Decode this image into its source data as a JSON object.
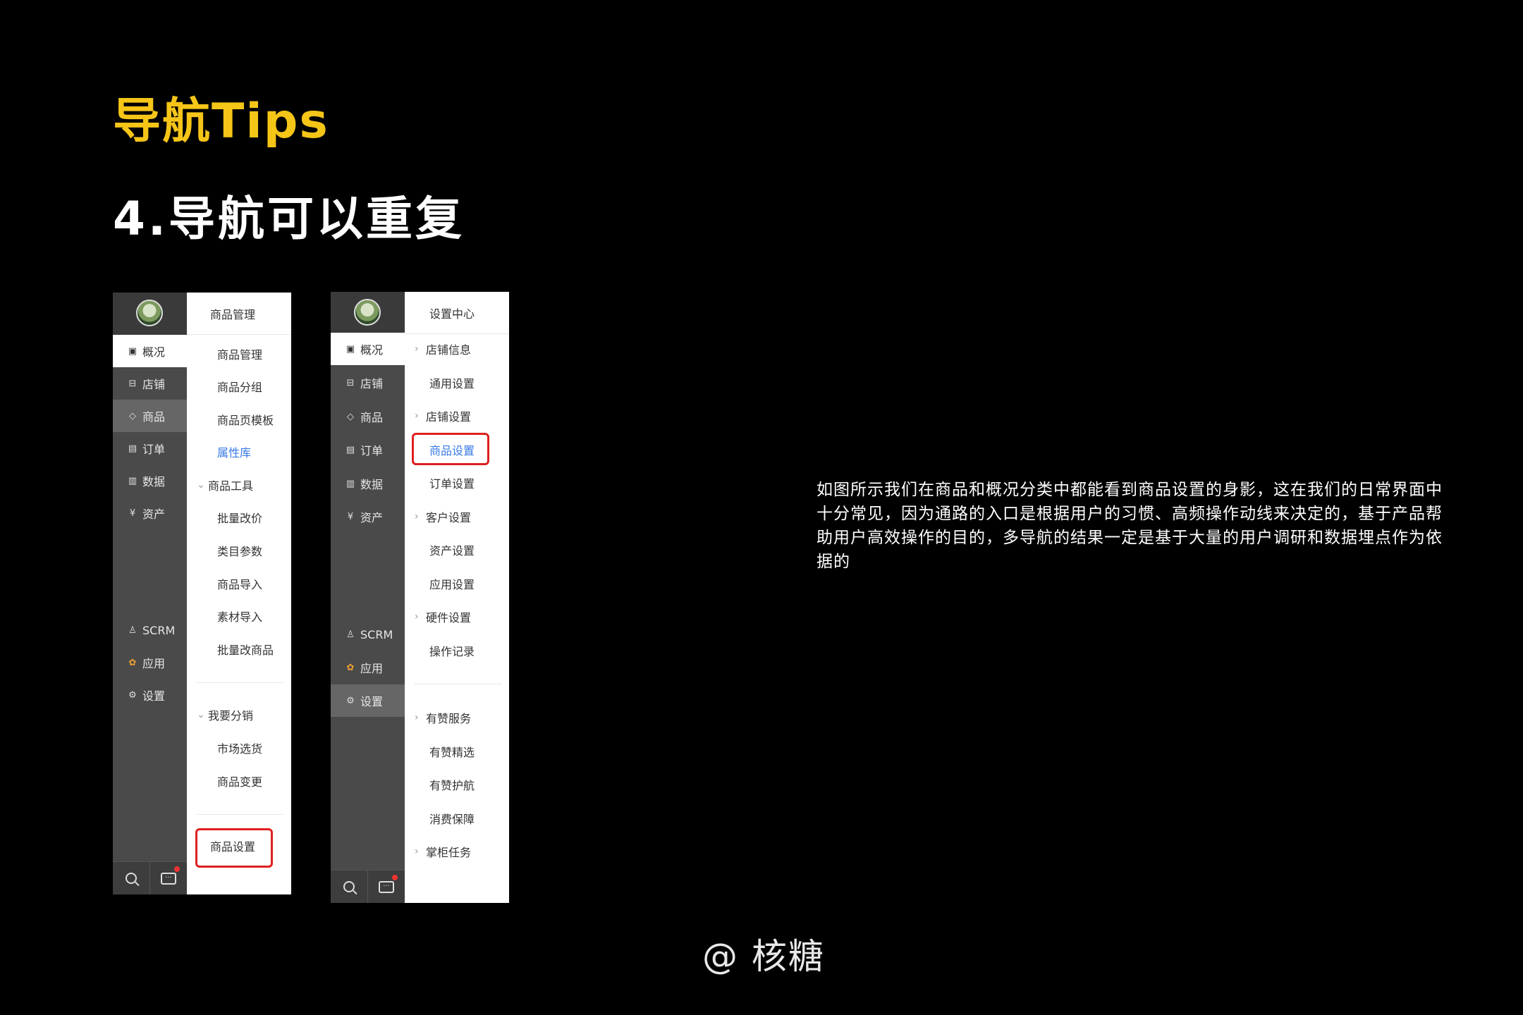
{
  "header": {
    "tips_title": "导航Tips",
    "subtitle": "4.导航可以重复"
  },
  "description": "如图所示我们在商品和概况分类中都能看到商品设置的身影，这在我们的日常界面中十分常见，因为通路的入口是根据用户的习惯、高频操作动线来决定的，基于产品帮助用户高效操作的目的，多导航的结果一定是基于大量的用户调研和数据埋点作为依据的",
  "credit": "@ 核糖",
  "colors": {
    "accent_yellow": "#f5c518",
    "rail_bg": "#4a4a4a",
    "link_blue": "#3778e6",
    "highlight_red": "#e02020"
  },
  "rail_items": [
    {
      "label": "概况",
      "icon": "dashboard-icon"
    },
    {
      "label": "店铺",
      "icon": "store-icon"
    },
    {
      "label": "商品",
      "icon": "tag-icon"
    },
    {
      "label": "订单",
      "icon": "order-icon"
    },
    {
      "label": "数据",
      "icon": "chart-icon"
    },
    {
      "label": "资产",
      "icon": "yen-icon"
    },
    {
      "label": "SCRM",
      "icon": "user-icon"
    },
    {
      "label": "应用",
      "icon": "apps-icon"
    },
    {
      "label": "设置",
      "icon": "gear-icon"
    }
  ],
  "left_panel": {
    "title": "商品管理",
    "items": [
      {
        "label": "商品管理"
      },
      {
        "label": "商品分组"
      },
      {
        "label": "商品页模板"
      },
      {
        "label": "属性库"
      },
      {
        "label": "商品工具"
      },
      {
        "label": "批量改价"
      },
      {
        "label": "类目参数"
      },
      {
        "label": "商品导入"
      },
      {
        "label": "素材导入"
      },
      {
        "label": "批量改商品"
      },
      {
        "label": "我要分销"
      },
      {
        "label": "市场选货"
      },
      {
        "label": "商品变更"
      },
      {
        "label": "商品设置"
      }
    ]
  },
  "right_panel": {
    "title": "设置中心",
    "items": [
      {
        "label": "店铺信息"
      },
      {
        "label": "通用设置"
      },
      {
        "label": "店铺设置"
      },
      {
        "label": "商品设置"
      },
      {
        "label": "订单设置"
      },
      {
        "label": "客户设置"
      },
      {
        "label": "资产设置"
      },
      {
        "label": "应用设置"
      },
      {
        "label": "硬件设置"
      },
      {
        "label": "操作记录"
      },
      {
        "label": "有赞服务"
      },
      {
        "label": "有赞精选"
      },
      {
        "label": "有赞护航"
      },
      {
        "label": "消费保障"
      },
      {
        "label": "掌柜任务"
      }
    ]
  },
  "glyphs": {
    "chev_right": "›",
    "chev_down": "⌄",
    "chat_dots": "···"
  }
}
